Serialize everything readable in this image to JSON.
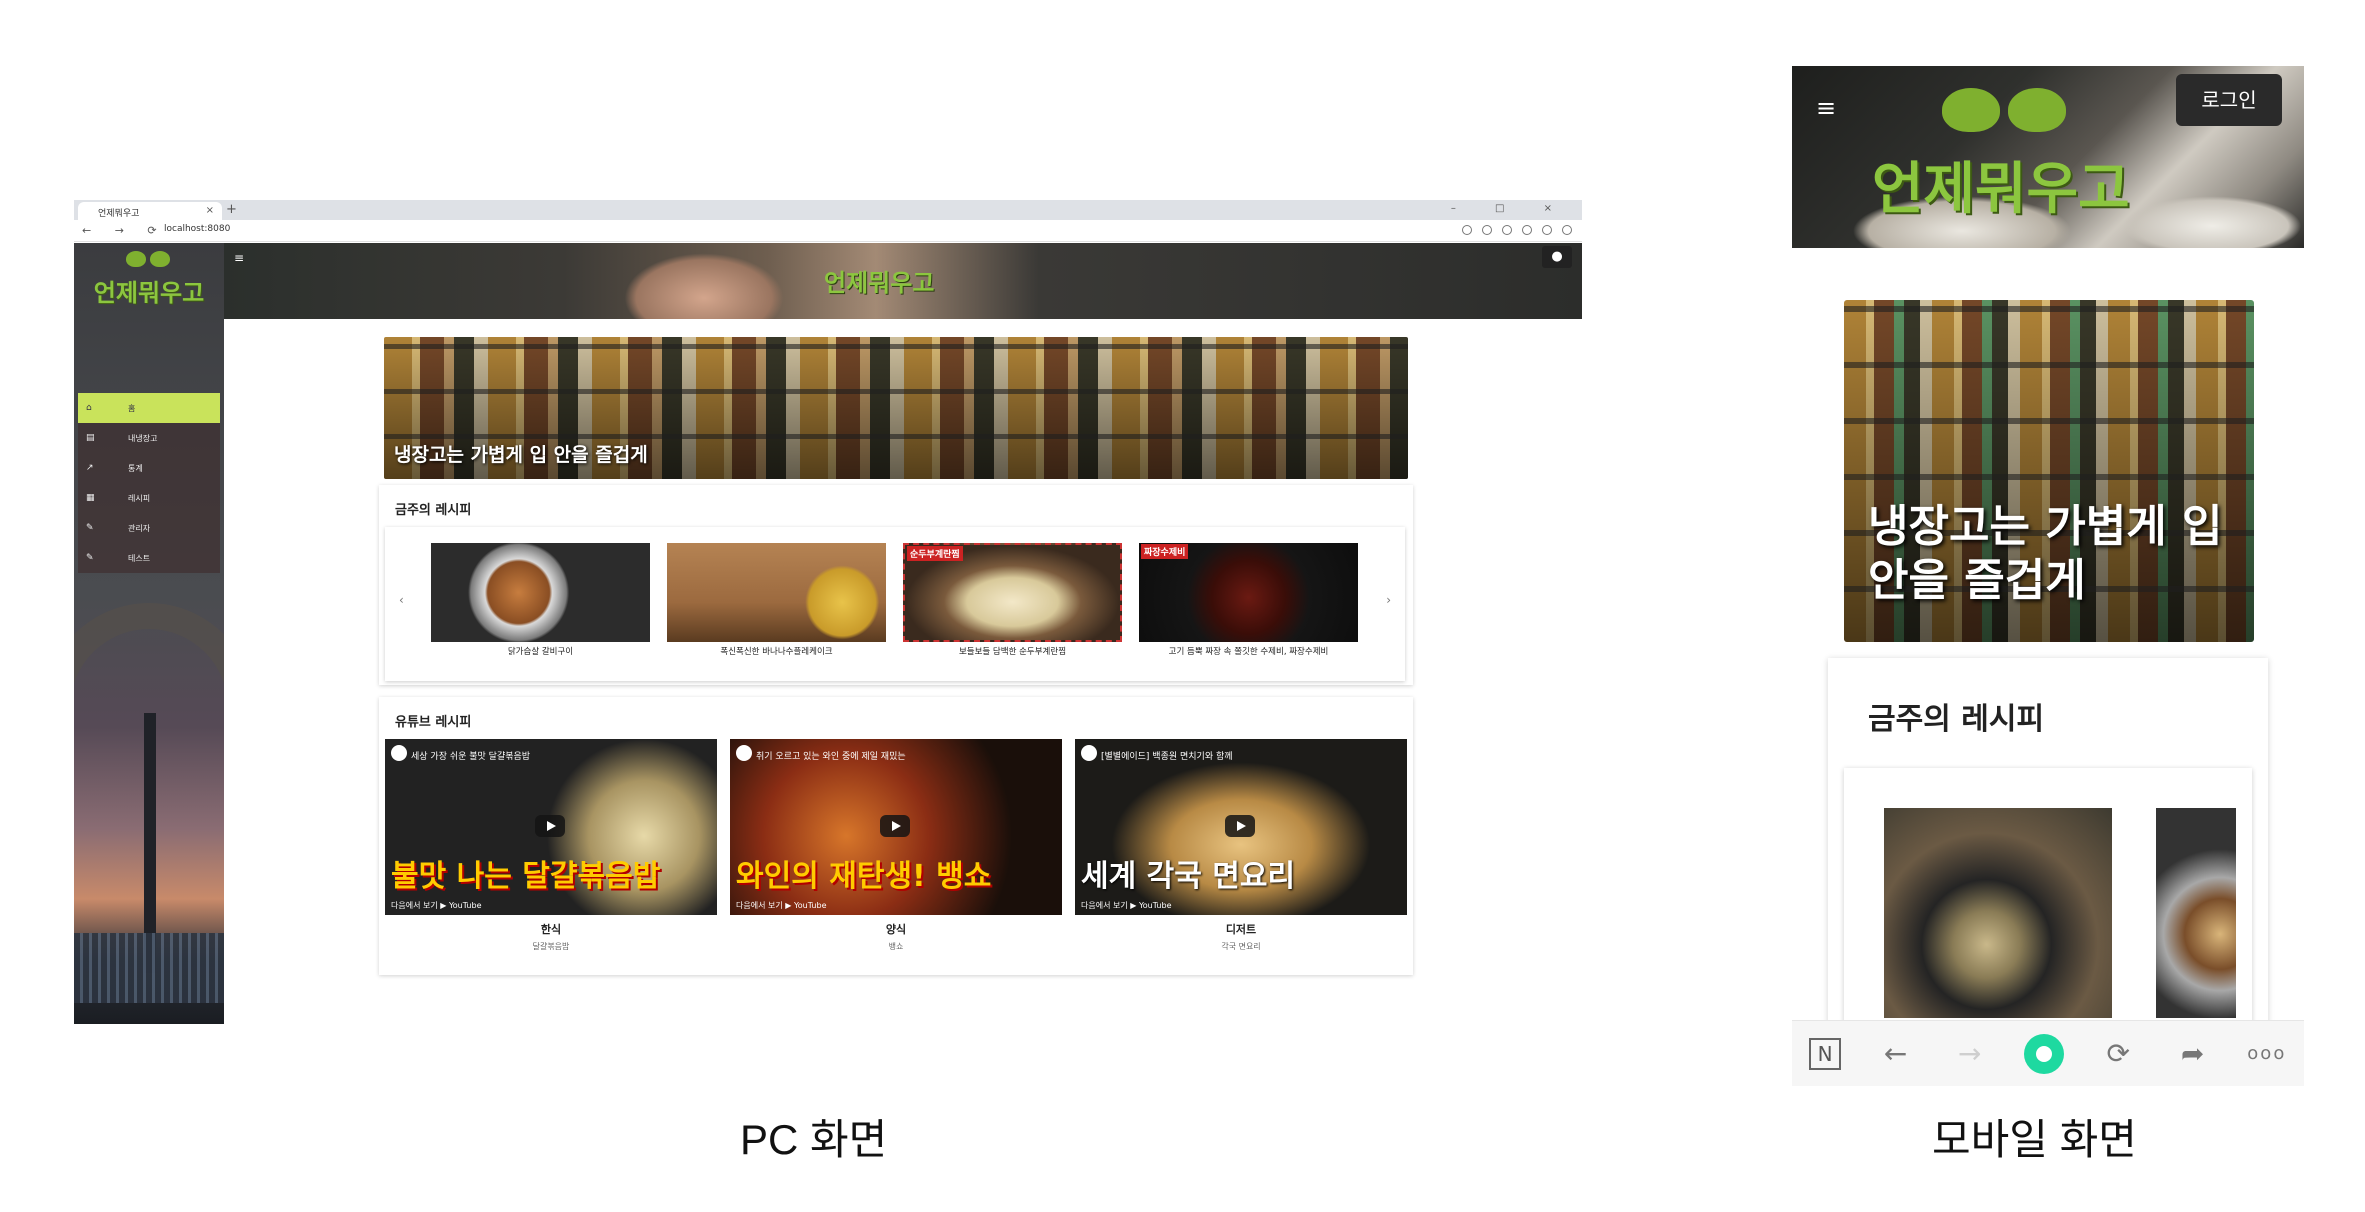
{
  "pc": {
    "browser": {
      "tab_title": "언제뭐우고",
      "tab_close": "×",
      "new_tab": "+",
      "window_controls": "– □ ×",
      "nav_buttons": "← → ⟳",
      "url": "localhost:8080"
    },
    "sidebar": {
      "logo_text": "언제뭐우고",
      "menu_items": [
        {
          "icon": "home-icon",
          "glyph": "⌂",
          "label": "홈",
          "active": true
        },
        {
          "icon": "fridge-icon",
          "glyph": "▤",
          "label": "내냉장고",
          "active": false
        },
        {
          "icon": "chart-icon",
          "glyph": "↗",
          "label": "통계",
          "active": false
        },
        {
          "icon": "recipe-icon",
          "glyph": "▦",
          "label": "레시피",
          "active": false
        },
        {
          "icon": "wrench-icon",
          "glyph": "✎",
          "label": "관리자",
          "active": false
        },
        {
          "icon": "wrench-icon",
          "glyph": "✎",
          "label": "테스트",
          "active": false
        }
      ]
    },
    "header": {
      "menu_glyph": "≡",
      "logo_text": "언제뭐우고",
      "account_glyph": "●"
    },
    "banner": {
      "text": "냉장고는 가볍게 입 안을 즐겁게"
    },
    "weekly": {
      "title": "금주의 레시피",
      "prev": "‹",
      "next": "›",
      "recipes": [
        {
          "caption": "닭가슴살 갈비구이",
          "tag": ""
        },
        {
          "caption": "폭신폭신한 바나나수플레케이크",
          "tag": ""
        },
        {
          "caption": "보들보들 담백한 순두부계란찜",
          "tag": "순두부계란찜"
        },
        {
          "caption": "고기 듬뿍 짜장 속 쫄깃한 수제비, 짜장수제비",
          "tag": "짜장수제비"
        }
      ]
    },
    "youtube": {
      "title": "유튜브 레시피",
      "watch_label": "다음에서 보기",
      "platform": "YouTube",
      "videos": [
        {
          "title": "세상 가장 쉬운 불맛 달걀볶음밥",
          "overlay": "불맛 나는 달걀볶음밥",
          "category": "한식",
          "subtitle": "달걀볶음밥"
        },
        {
          "title": "취기 오르고 있는 와인 중에 제일 재밌는",
          "overlay": "와인의 재탄생! 뱅쇼",
          "category": "양식",
          "subtitle": "뱅쇼"
        },
        {
          "title": "[별별에이드] 백종원 면치기와 함께",
          "overlay": "세계 각국 면요리",
          "category": "디저트",
          "subtitle": "각국 면요리"
        }
      ]
    }
  },
  "mobile": {
    "header": {
      "menu_glyph": "≡",
      "logo_text": "언제뭐우고",
      "login_label": "로그인"
    },
    "banner": {
      "text": "냉장고는 가볍게 입 안을 즐겁게"
    },
    "weekly": {
      "title": "금주의 레시피"
    },
    "bottom_bar": {
      "n_label": "N",
      "back": "←",
      "forward": "→",
      "refresh": "⟳",
      "share": "➦",
      "more": "ooo"
    }
  },
  "captions": {
    "pc": "PC 화면",
    "mobile": "모바일 화면"
  }
}
